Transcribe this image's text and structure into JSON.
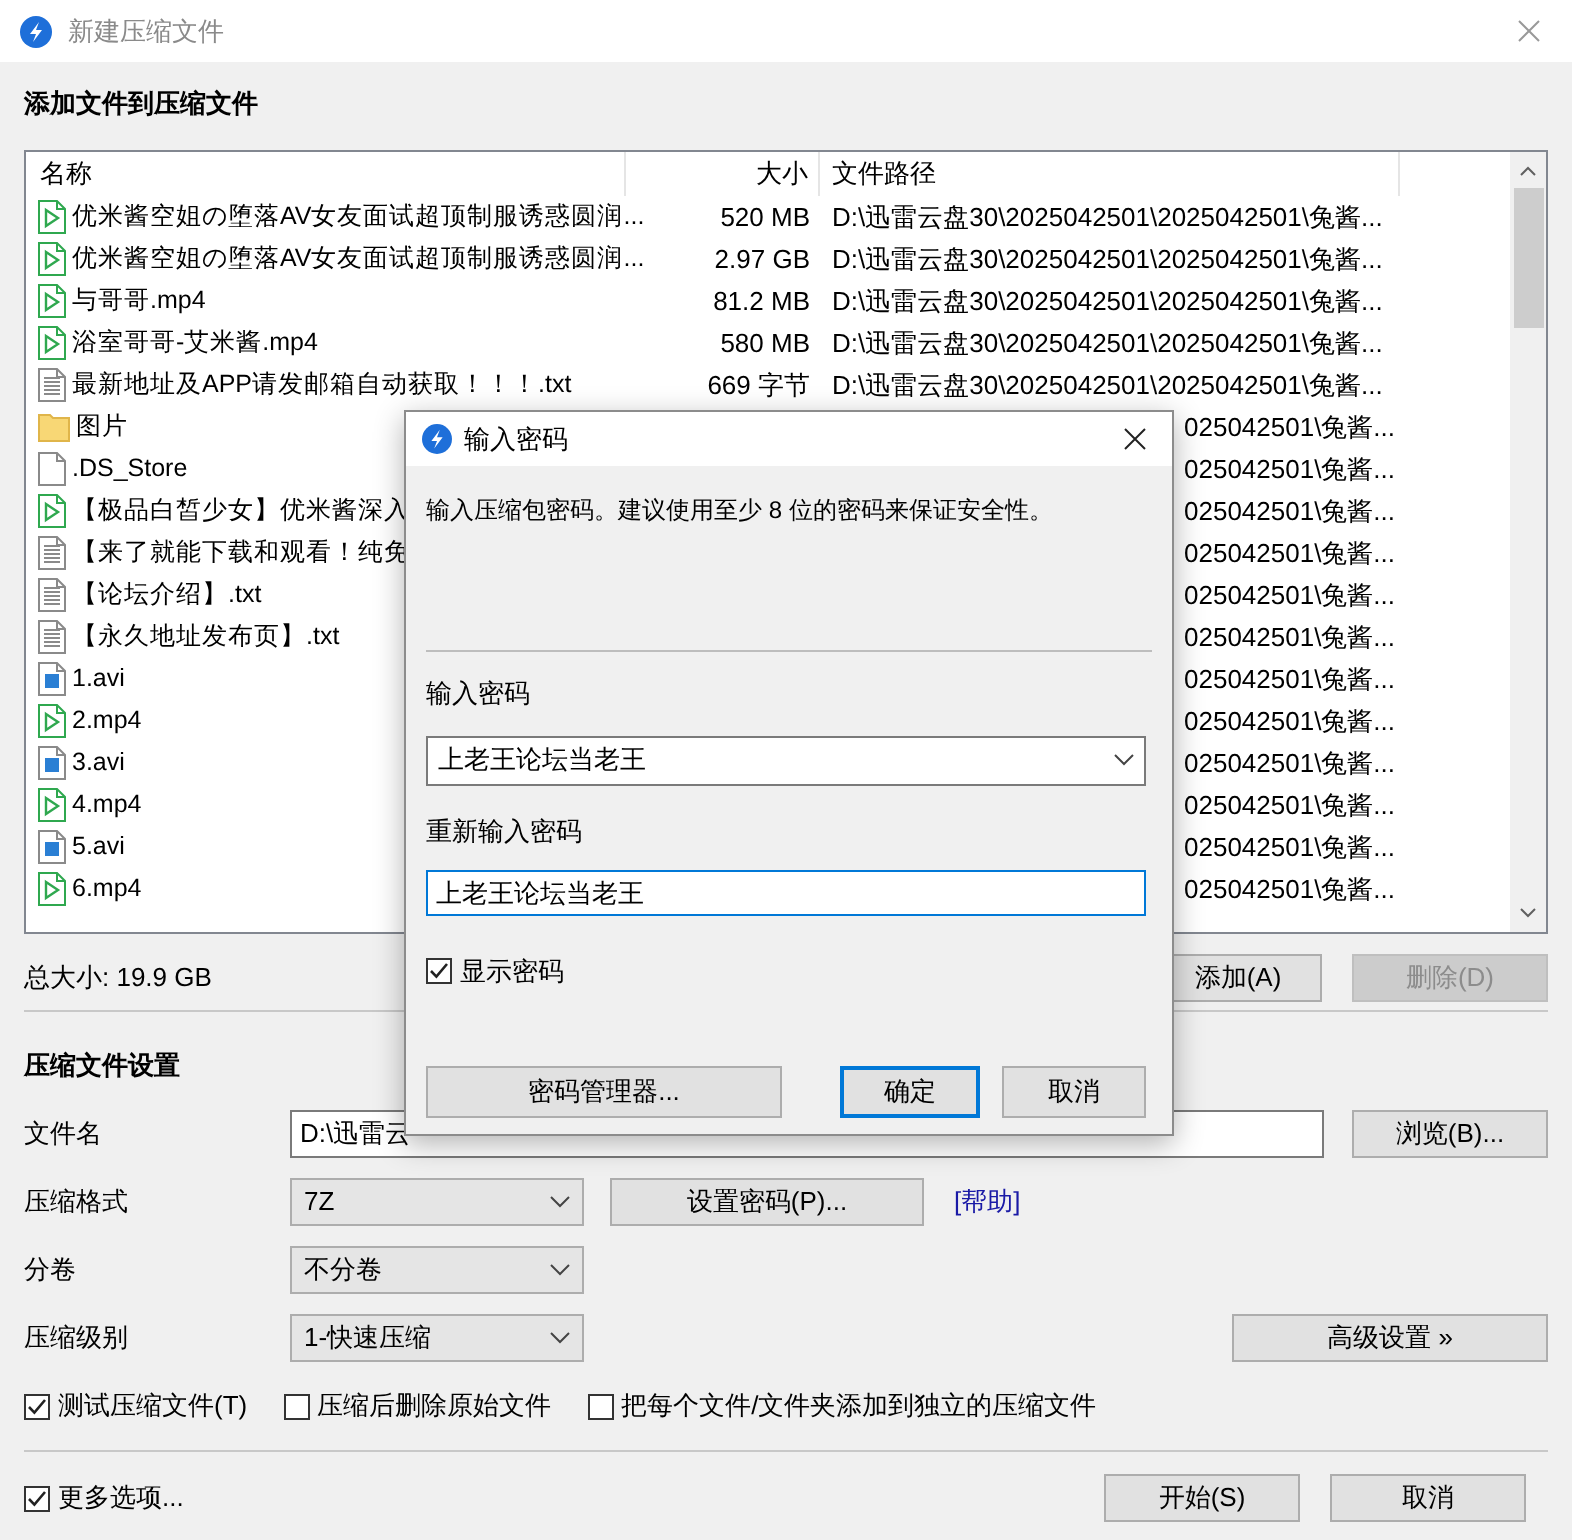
{
  "window": {
    "title": "新建压缩文件"
  },
  "files": {
    "heading": "添加文件到压缩文件",
    "columns": [
      "名称",
      "大小",
      "文件路径"
    ],
    "rows": [
      {
        "kind": "video",
        "name": "优米酱空姐の堕落AV女友面试超顶制服诱惑圆润...",
        "size": "520 MB",
        "path": "D:\\迅雷云盘30\\2025042501\\2025042501\\兔酱..."
      },
      {
        "kind": "video",
        "name": "优米酱空姐の堕落AV女友面试超顶制服诱惑圆润...",
        "size": "2.97 GB",
        "path": "D:\\迅雷云盘30\\2025042501\\2025042501\\兔酱..."
      },
      {
        "kind": "video",
        "name": "与哥哥.mp4",
        "size": "81.2 MB",
        "path": "D:\\迅雷云盘30\\2025042501\\2025042501\\兔酱..."
      },
      {
        "kind": "video",
        "name": "浴室哥哥-艾米酱.mp4",
        "size": "580 MB",
        "path": "D:\\迅雷云盘30\\2025042501\\2025042501\\兔酱..."
      },
      {
        "kind": "text",
        "name": "最新地址及APP请发邮箱自动获取！！！.txt",
        "size": "669 字节",
        "path": "D:\\迅雷云盘30\\2025042501\\2025042501\\兔酱..."
      },
      {
        "kind": "folder",
        "name": "图片",
        "path": "025042501\\兔酱..."
      },
      {
        "kind": "file",
        "name": ".DS_Store",
        "path": "025042501\\兔酱..."
      },
      {
        "kind": "video",
        "name": "【极品白皙少女】优米酱深入",
        "path": "025042501\\兔酱..."
      },
      {
        "kind": "text",
        "name": "【来了就能下载和观看！纯免",
        "path": "025042501\\兔酱..."
      },
      {
        "kind": "text",
        "name": "【论坛介绍】.txt",
        "path": "025042501\\兔酱..."
      },
      {
        "kind": "text",
        "name": "【永久地址发布页】.txt",
        "path": "025042501\\兔酱..."
      },
      {
        "kind": "image",
        "name": "1.avi",
        "path": "025042501\\兔酱..."
      },
      {
        "kind": "video",
        "name": "2.mp4",
        "path": "025042501\\兔酱..."
      },
      {
        "kind": "image",
        "name": "3.avi",
        "path": "025042501\\兔酱..."
      },
      {
        "kind": "video",
        "name": "4.mp4",
        "path": "025042501\\兔酱..."
      },
      {
        "kind": "image",
        "name": "5.avi",
        "path": "025042501\\兔酱..."
      },
      {
        "kind": "video",
        "name": "6.mp4",
        "path": "025042501\\兔酱..."
      }
    ],
    "total": "总大小: 19.9 GB",
    "buttons": [
      {
        "label": "添加(A)",
        "disabled": false
      },
      {
        "label": "删除(D)",
        "disabled": true
      }
    ]
  },
  "settings": {
    "heading": "压缩文件设置",
    "filename": {
      "label": "文件名",
      "value": "D:\\迅雷云"
    },
    "browse_button": "浏览(B)...",
    "format": {
      "label": "压缩格式",
      "value": "7Z"
    },
    "password_button": "设置密码(P)...",
    "help_link": "[帮助]",
    "split": {
      "label": "分卷",
      "value": "不分卷"
    },
    "level": {
      "label": "压缩级别",
      "value": "1-快速压缩"
    },
    "advanced_button": "高级设置 »",
    "options": [
      {
        "label": "测试压缩文件(T)",
        "checked": true
      },
      {
        "label": "压缩后删除原始文件",
        "checked": false
      },
      {
        "label": "把每个文件/文件夹添加到独立的压缩文件",
        "checked": false
      }
    ]
  },
  "footer": {
    "more_options": {
      "label": "更多选项...",
      "checked": true
    },
    "buttons": [
      "开始(S)",
      "取消"
    ]
  },
  "dialog": {
    "title": "输入密码",
    "description": "输入压缩包密码。建议使用至少 8 位的密码来保证安全性。",
    "password": {
      "label": "输入密码",
      "value": "上老王论坛当老王"
    },
    "confirm": {
      "label": "重新输入密码",
      "value": "上老王论坛当老王"
    },
    "show_password": {
      "label": "显示密码",
      "checked": true
    },
    "buttons": [
      {
        "label": "密码管理器...",
        "default": false
      },
      {
        "label": "确定",
        "default": true
      },
      {
        "label": "取消",
        "default": false
      }
    ]
  }
}
